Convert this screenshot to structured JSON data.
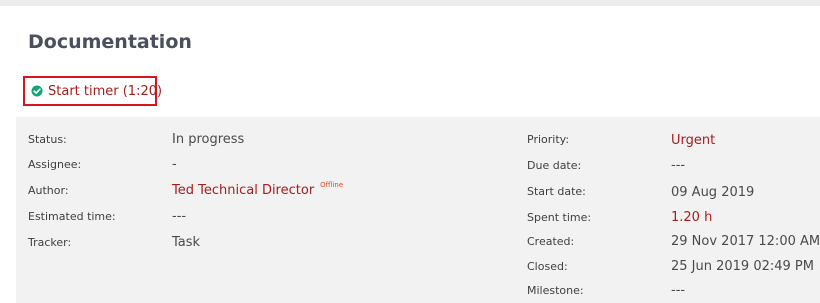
{
  "page": {
    "title": "Documentation"
  },
  "timer": {
    "label": "Start timer (1:20)"
  },
  "colors": {
    "accent_red": "#a51d1d",
    "highlight_border": "#d7141f",
    "check_icon": "#1aa37a"
  },
  "icons": {
    "timer": "check-circle-icon"
  },
  "left_fields": [
    {
      "label": "Status:",
      "value": "In progress"
    },
    {
      "label": "Assignee:",
      "value": "-"
    },
    {
      "label": "Author:",
      "value": "Ted Technical Director",
      "badge": "Offline"
    },
    {
      "label": "Estimated time:",
      "value": "---"
    },
    {
      "label": "Tracker:",
      "value": "Task"
    }
  ],
  "right_fields": [
    {
      "label": "Priority:",
      "value": "Urgent"
    },
    {
      "label": "Due date:",
      "value": "---"
    },
    {
      "label": "Start date:",
      "value": "09 Aug 2019"
    },
    {
      "label": "Spent time:",
      "value": "1.20 h"
    },
    {
      "label": "Created:",
      "value": "29 Nov 2017 12:00 AM"
    },
    {
      "label": "Closed:",
      "value": "25 Jun 2019 02:49 PM"
    },
    {
      "label": "Milestone:",
      "value": "---"
    }
  ]
}
